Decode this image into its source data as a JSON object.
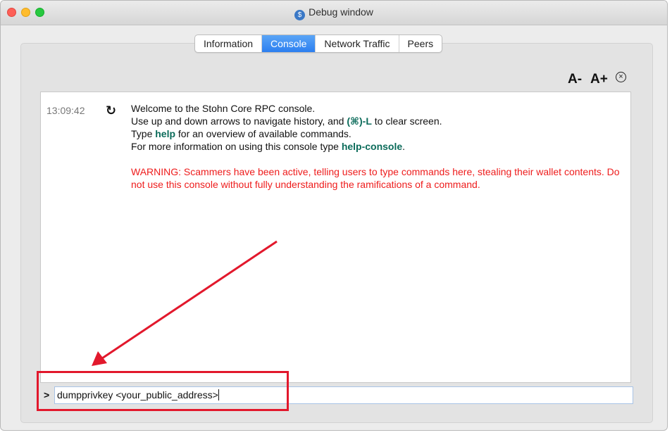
{
  "window": {
    "title": "Debug window"
  },
  "tabs": [
    {
      "label": "Information",
      "active": false
    },
    {
      "label": "Console",
      "active": true
    },
    {
      "label": "Network Traffic",
      "active": false
    },
    {
      "label": "Peers",
      "active": false
    }
  ],
  "toolbar": {
    "font_smaller": "A-",
    "font_larger": "A+",
    "clear_icon": "clear-circle-icon"
  },
  "console": {
    "timestamp": "13:09:42",
    "line1": "Welcome to the Stohn Core RPC console.",
    "line2_pre": "Use up and down arrows to navigate history, and ",
    "line2_kw": "(⌘)-L",
    "line2_post": " to clear screen.",
    "line3_pre": "Type ",
    "line3_kw": "help",
    "line3_post": " for an overview of available commands.",
    "line4_pre": "For more information on using this console type ",
    "line4_kw": "help-console",
    "line4_post": ".",
    "warning": "WARNING: Scammers have been active, telling users to type commands here, stealing their wallet contents. Do not use this console without fully understanding the ramifications of a command."
  },
  "input": {
    "prompt": ">",
    "value": "dumpprivkey <your_public_address>"
  },
  "colors": {
    "accent": "#2c7ff0",
    "warning": "#ee1c1c",
    "keyword": "#0b6b5a",
    "annotation": "#e2182c"
  }
}
